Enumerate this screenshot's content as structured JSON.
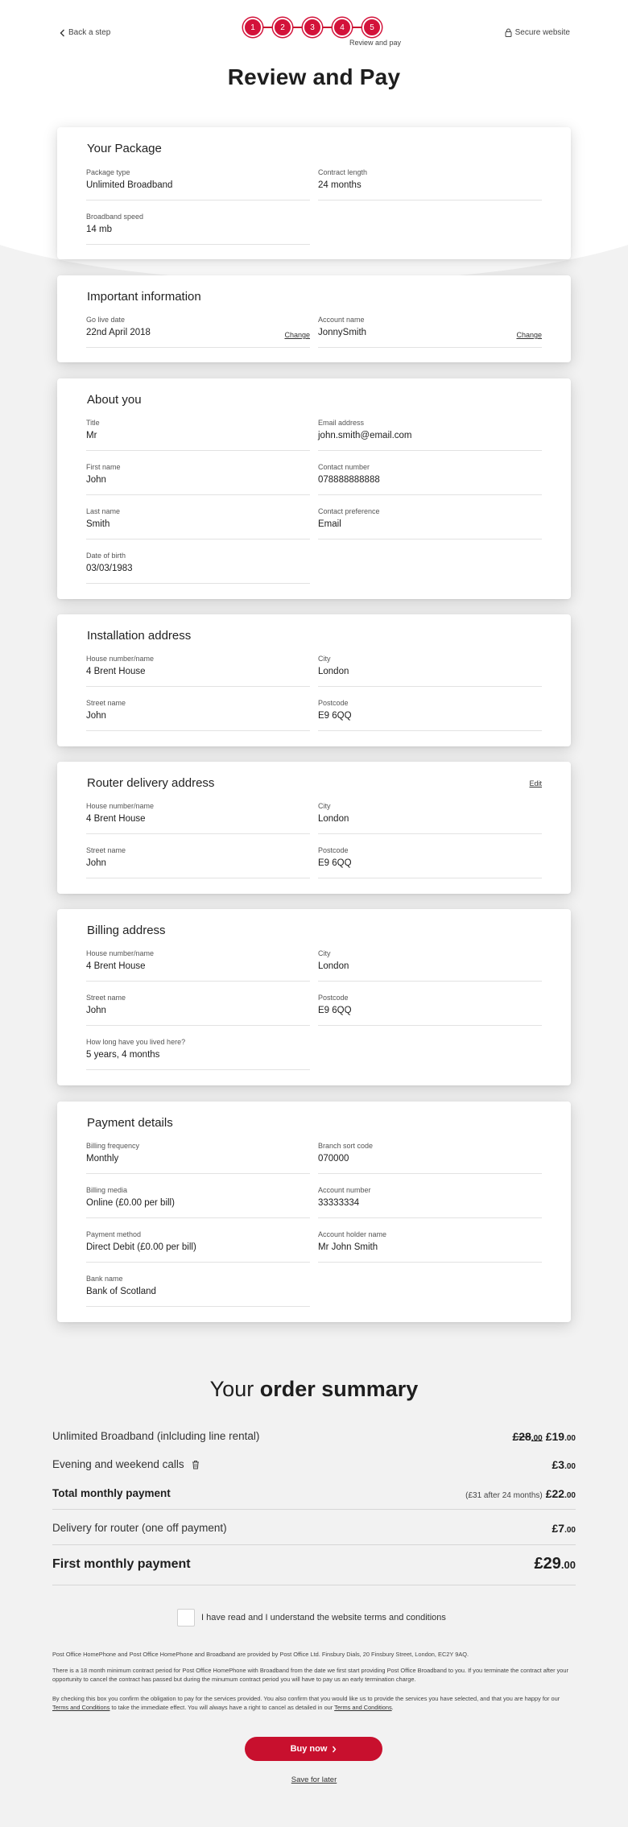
{
  "header": {
    "back_label": "Back a step",
    "secure_label": "Secure website",
    "steps": [
      "1",
      "2",
      "3",
      "4",
      "5"
    ],
    "step_caption": "Review and pay",
    "page_title": "Review and Pay"
  },
  "cards": {
    "package": {
      "title": "Your Package",
      "package_type_label": "Package type",
      "package_type_value": "Unlimited Broadband",
      "contract_length_label": "Contract length",
      "contract_length_value": "24 months",
      "speed_label": "Broadband speed",
      "speed_value": "14 mb"
    },
    "important": {
      "title": "Important information",
      "go_live_label": "Go live date",
      "go_live_value": "22nd April 2018",
      "account_name_label": "Account name",
      "account_name_value": "JonnySmith",
      "change_label": "Change"
    },
    "about": {
      "title": "About you",
      "title_label": "Title",
      "title_value": "Mr",
      "email_label": "Email address",
      "email_value": "john.smith@email.com",
      "first_name_label": "First name",
      "first_name_value": "John",
      "contact_number_label": "Contact number",
      "contact_number_value": "078888888888",
      "last_name_label": "Last name",
      "last_name_value": "Smith",
      "contact_pref_label": "Contact preference",
      "contact_pref_value": "Email",
      "dob_label": "Date of birth",
      "dob_value": "03/03/1983"
    },
    "installation": {
      "title": "Installation address",
      "house_label": "House number/name",
      "house_value": "4 Brent House",
      "city_label": "City",
      "city_value": "London",
      "street_label": "Street name",
      "street_value": "John",
      "postcode_label": "Postcode",
      "postcode_value": "E9 6QQ"
    },
    "router": {
      "title": "Router delivery address",
      "edit_label": "Edit",
      "house_label": "House number/name",
      "house_value": "4 Brent House",
      "city_label": "City",
      "city_value": "London",
      "street_label": "Street name",
      "street_value": "John",
      "postcode_label": "Postcode",
      "postcode_value": "E9 6QQ"
    },
    "billing": {
      "title": "Billing address",
      "house_label": "House number/name",
      "house_value": "4 Brent House",
      "city_label": "City",
      "city_value": "London",
      "street_label": "Street name",
      "street_value": "John",
      "postcode_label": "Postcode",
      "postcode_value": "E9 6QQ",
      "lived_label": "How long have you lived here?",
      "lived_value": "5 years, 4 months"
    },
    "payment": {
      "title": "Payment details",
      "frequency_label": "Billing frequency",
      "frequency_value": "Monthly",
      "sort_code_label": "Branch sort code",
      "sort_code_value": "070000",
      "media_label": "Billing media",
      "media_value": "Online (£0.00 per bill)",
      "account_number_label": "Account number",
      "account_number_value": "33333334",
      "method_label": "Payment method",
      "method_value": "Direct Debit (£0.00 per bill)",
      "holder_label": "Account holder name",
      "holder_value": "Mr John Smith",
      "bank_label": "Bank name",
      "bank_value": "Bank of Scotland"
    }
  },
  "summary": {
    "title_prefix": "Your",
    "title_bold": "order summary",
    "broadband_label": "Unlimited Broadband (inlcluding line rental)",
    "broadband_old_pounds": "£28",
    "broadband_old_pence": ".00",
    "broadband_new_pounds": "£19",
    "broadband_new_pence": ".00",
    "calls_label": "Evening and weekend calls",
    "calls_pounds": "£3",
    "calls_pence": ".00",
    "total_monthly_label": "Total monthly payment",
    "total_monthly_note": "(£31 after 24 months)",
    "total_monthly_pounds": "£22",
    "total_monthly_pence": ".00",
    "delivery_label": "Delivery for router (one off payment)",
    "delivery_pounds": "£7",
    "delivery_pence": ".00",
    "first_monthly_label": "First monthly payment",
    "first_monthly_pounds": "£29",
    "first_monthly_pence": ".00"
  },
  "terms": {
    "checkbox_label": "I have read and I understand the website terms and conditions",
    "para1": "Post Office HomePhone and Post Office HomePhone and Broadband are provided by Post Office Ltd. Finsbury Dials, 20 Finsbury Street, London, EC2Y 9AQ.",
    "para2": "There is a 18 month minimum contract period for Post Office HomePhone with Broadband from the date we first start providing Post Office Broadband to you. If you terminate the contract after your opportunity to cancel the contract has passed but during the minumum contract period you will have to pay us an early termination charge.",
    "para3_a": "By checking this box you confirm the obligation to pay for the services provided. You also confirm that you would like us to provide the services you have selected, and that you are happy for our ",
    "para3_link1": "Terms and Conditions",
    "para3_b": " to take the immediate effect. You will always have a right to cancel as detailed in our ",
    "para3_link2": "Terms and Conditions",
    "para3_c": "."
  },
  "actions": {
    "buy_label": "Buy now",
    "save_label": "Save for later"
  },
  "colors": {
    "brand_red": "#c8102e",
    "background": "#f2f2f2"
  }
}
